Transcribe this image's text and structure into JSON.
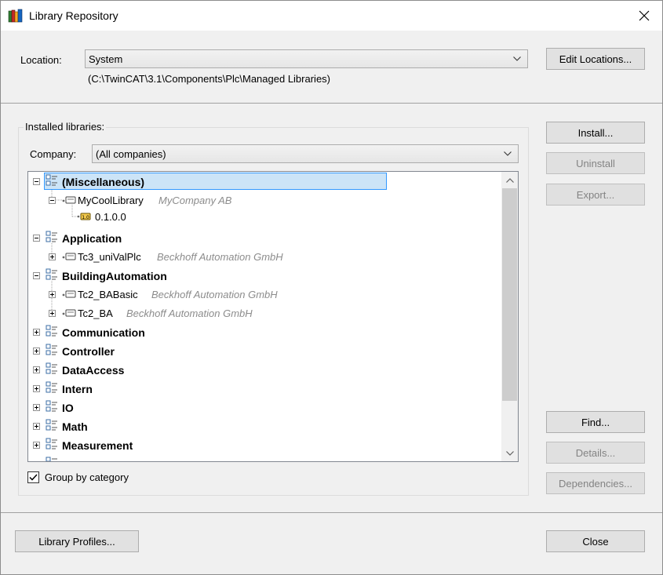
{
  "window": {
    "title": "Library Repository",
    "close_glyph": "✕"
  },
  "location": {
    "label": "Location:",
    "value": "System",
    "path": "(C:\\TwinCAT\\3.1\\Components\\Plc\\Managed Libraries)",
    "edit_button": "Edit Locations..."
  },
  "installed": {
    "group_title": "Installed libraries:",
    "company_label": "Company:",
    "company_value": "(All companies)",
    "group_by_category": "Group by category",
    "group_by_checked": true,
    "tree": {
      "misc": "(Miscellaneous)",
      "mycool_name": "MyCoolLibrary",
      "mycool_company": "MyCompany AB",
      "mycool_version": "0.1.0.0",
      "application": "Application",
      "univalplc_name": "Tc3_uniValPlc",
      "univalplc_company": "Beckhoff Automation GmbH",
      "buildingautomation": "BuildingAutomation",
      "babasic_name": "Tc2_BABasic",
      "babasic_company": "Beckhoff Automation GmbH",
      "ba_name": "Tc2_BA",
      "ba_company": "Beckhoff Automation GmbH",
      "communication": "Communication",
      "controller": "Controller",
      "dataaccess": "DataAccess",
      "intern": "Intern",
      "io": "IO",
      "math": "Math",
      "measurement": "Measurement"
    }
  },
  "buttons": {
    "install": "Install...",
    "uninstall": "Uninstall",
    "export": "Export...",
    "find": "Find...",
    "details": "Details...",
    "dependencies": "Dependencies...",
    "library_profiles": "Library Profiles...",
    "close": "Close"
  },
  "colors": {
    "selection_fill": "#cce4f7",
    "selection_border": "#3399ff",
    "disabled_text": "#838383",
    "company_text": "#8c8c8c"
  }
}
